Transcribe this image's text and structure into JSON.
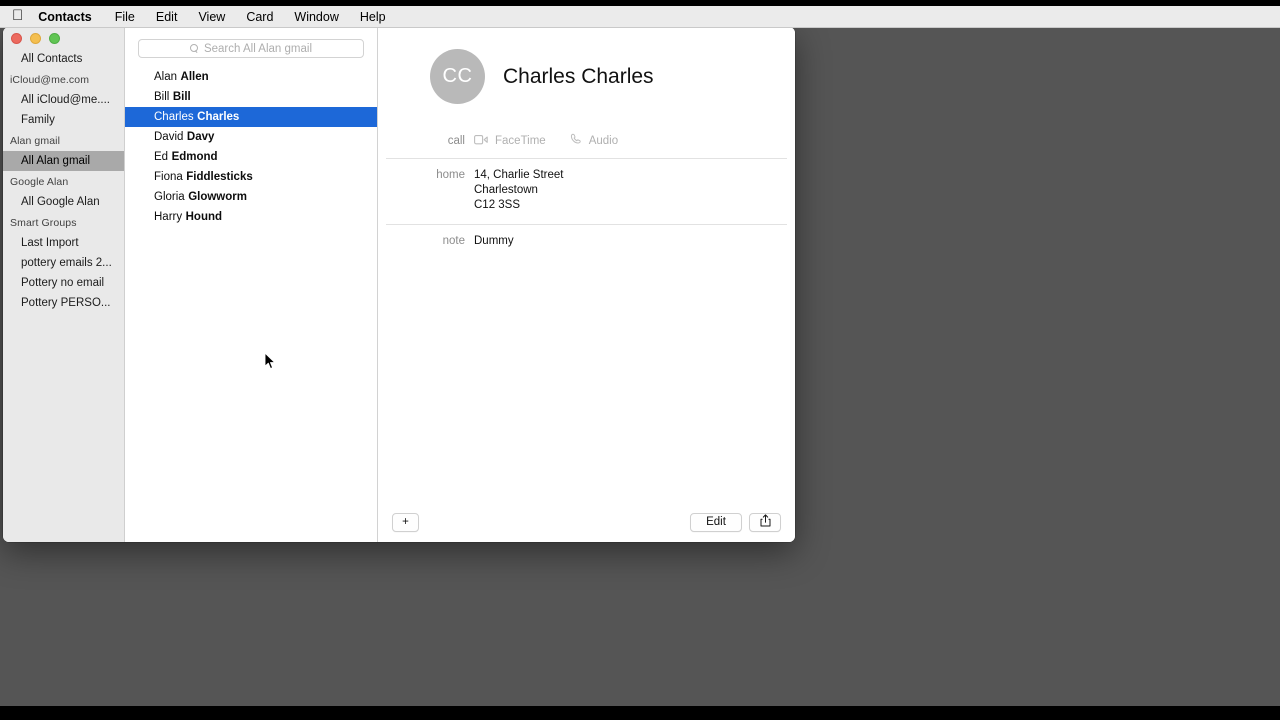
{
  "menubar": {
    "apple_icon": "apple-logo-icon",
    "items": [
      {
        "label": "Contacts",
        "bold": true
      },
      {
        "label": "File",
        "bold": false
      },
      {
        "label": "Edit",
        "bold": false
      },
      {
        "label": "View",
        "bold": false
      },
      {
        "label": "Card",
        "bold": false
      },
      {
        "label": "Window",
        "bold": false
      },
      {
        "label": "Help",
        "bold": false
      }
    ]
  },
  "window": {
    "traffic_lights": [
      "close",
      "minimize",
      "zoom"
    ]
  },
  "sidebar": {
    "rows": [
      {
        "label": "All Contacts",
        "type": "item",
        "selected": false
      },
      {
        "label": "iCloud@me.com",
        "type": "header",
        "selected": false
      },
      {
        "label": "All iCloud@me....",
        "type": "item",
        "selected": false
      },
      {
        "label": "Family",
        "type": "item",
        "selected": false
      },
      {
        "label": "Alan gmail",
        "type": "header",
        "selected": false
      },
      {
        "label": "All Alan gmail",
        "type": "item",
        "selected": true
      },
      {
        "label": "Google Alan",
        "type": "header",
        "selected": false
      },
      {
        "label": "All Google Alan",
        "type": "item",
        "selected": false
      },
      {
        "label": "Smart Groups",
        "type": "header",
        "selected": false
      },
      {
        "label": "Last Import",
        "type": "item",
        "selected": false
      },
      {
        "label": "pottery emails 2...",
        "type": "item",
        "selected": false
      },
      {
        "label": "Pottery no email",
        "type": "item",
        "selected": false
      },
      {
        "label": "Pottery PERSO...",
        "type": "item",
        "selected": false
      }
    ]
  },
  "search": {
    "placeholder": "Search All Alan gmail",
    "value": "",
    "icon": "search-icon"
  },
  "contacts": {
    "rows": [
      {
        "first": "Alan",
        "last": "Allen",
        "selected": false
      },
      {
        "first": "Bill",
        "last": "Bill",
        "selected": false
      },
      {
        "first": "Charles",
        "last": "Charles",
        "selected": true
      },
      {
        "first": "David",
        "last": "Davy",
        "selected": false
      },
      {
        "first": "Ed",
        "last": "Edmond",
        "selected": false
      },
      {
        "first": "Fiona",
        "last": "Fiddlesticks",
        "selected": false
      },
      {
        "first": "Gloria",
        "last": "Glowworm",
        "selected": false
      },
      {
        "first": "Harry",
        "last": "Hound",
        "selected": false
      }
    ]
  },
  "detail": {
    "initials": "CC",
    "name": "Charles Charles",
    "call": {
      "label": "call",
      "facetime_label": "FaceTime",
      "facetime_icon": "video-camera-icon",
      "audio_label": "Audio",
      "audio_icon": "phone-handset-icon"
    },
    "home": {
      "label": "home",
      "line1": "14, Charlie Street",
      "line2": "Charlestown",
      "line3": "C12 3SS"
    },
    "note": {
      "label": "note",
      "value": "Dummy"
    }
  },
  "bottombar": {
    "add_label": "+",
    "edit_label": "Edit",
    "share_icon": "share-icon"
  },
  "colors": {
    "selection_blue": "#1d68d8",
    "sidebar_selection": "#a9a9a9",
    "sidebar_bg": "#e9e9e9",
    "desktop": "#555555",
    "avatar_gray": "#b9b9b9",
    "menubar_bg": "#ebebeb"
  }
}
